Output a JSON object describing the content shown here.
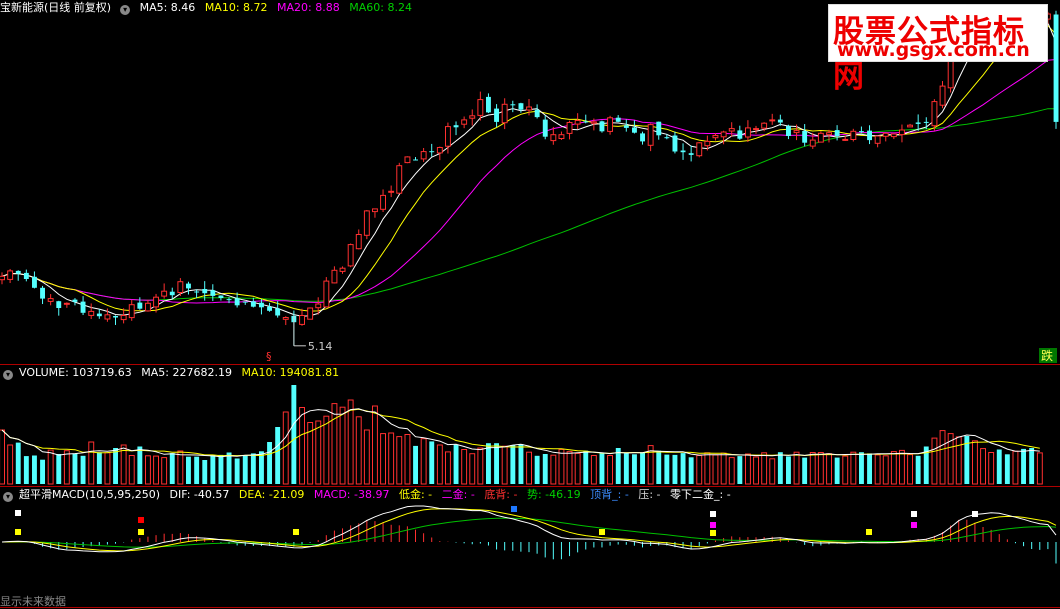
{
  "header_main": {
    "title": "宝新能源(日线 前复权)",
    "ma5": "MA5: 8.46",
    "ma10": "MA10: 8.72",
    "ma20": "MA20: 8.88",
    "ma60": "MA60: 8.24"
  },
  "header_volume": {
    "title": "VOLUME: 103719.63",
    "ma5": "MA5: 227682.19",
    "ma10": "MA10: 194081.81"
  },
  "header_macd": {
    "title": "超平滑MACD(10,5,95,250)",
    "dif": "DIF: -40.57",
    "dea": "DEA: -21.09",
    "macd": "MACD: -38.97",
    "dijin": "低金: -",
    "erjin": "二金: -",
    "dibei": "底背: -",
    "shi": "势: -46.19",
    "dingbei": "顶背_: -",
    "ya": "压: -",
    "lingxia": "零下二金_: -"
  },
  "watermark": {
    "line1": "股票公式指标网",
    "line2": "www.gsgx.com.cn"
  },
  "annotations": {
    "low_price": "5.14",
    "drop": "跌",
    "marker": "§",
    "future": "显示未来数据"
  },
  "colors": {
    "up": "#ff3030",
    "down": "#54ffff",
    "ma5": "#ffffff",
    "ma10": "#ffff00",
    "ma20": "#ff00ff",
    "ma60": "#00c000",
    "volume_ma5": "#ffffff",
    "volume_ma10": "#ffff00"
  },
  "chart_data": {
    "type": "candlestick",
    "ylim": [
      4.9,
      10.0
    ],
    "close": [
      6.17,
      6.25,
      6.21,
      6.13,
      6.0,
      5.84,
      5.84,
      5.7,
      5.77,
      5.79,
      5.63,
      5.65,
      5.58,
      5.6,
      5.56,
      5.59,
      5.75,
      5.69,
      5.77,
      5.86,
      5.95,
      5.89,
      6.09,
      5.99,
      5.94,
      5.92,
      5.88,
      5.85,
      5.82,
      5.74,
      5.79,
      5.72,
      5.71,
      5.66,
      5.59,
      5.56,
      5.49,
      5.59,
      5.7,
      5.76,
      6.1,
      6.26,
      6.29,
      6.64,
      6.79,
      7.14,
      7.17,
      7.37,
      7.43,
      7.81,
      7.94,
      7.9,
      8.02,
      8.01,
      8.08,
      8.39,
      8.38,
      8.49,
      8.55,
      8.79,
      8.6,
      8.46,
      8.72,
      8.71,
      8.64,
      8.68,
      8.53,
      8.24,
      8.27,
      8.27,
      8.45,
      8.48,
      8.46,
      8.46,
      8.32,
      8.52,
      8.46,
      8.37,
      8.3,
      8.17,
      8.42,
      8.26,
      8.23,
      8.02,
      8.01,
      7.97,
      8.15,
      8.17,
      8.26,
      8.31,
      8.36,
      8.21,
      8.37,
      8.36,
      8.44,
      8.49,
      8.45,
      8.25,
      8.33,
      8.15,
      8.19,
      8.29,
      8.3,
      8.25,
      8.2,
      8.32,
      8.32,
      8.19,
      8.25,
      8.29,
      8.28,
      8.34,
      8.41,
      8.43,
      8.46,
      8.76,
      8.99,
      9.51,
      9.79,
      9.67,
      9.73,
      9.77,
      10.0,
      9.9,
      9.82,
      9.9,
      9.9,
      9.83,
      9.95,
      10.06,
      8.46
    ],
    "volume": [
      180000,
      130000,
      138000,
      93000,
      95000,
      81000,
      113000,
      100000,
      111000,
      102000,
      94000,
      140000,
      106000,
      104000,
      120000,
      130000,
      95000,
      125000,
      94000,
      93000,
      88000,
      103000,
      110000,
      91000,
      91000,
      80000,
      96000,
      97000,
      105000,
      85000,
      95000,
      102000,
      109000,
      140000,
      190000,
      240000,
      330000,
      255000,
      205000,
      210000,
      226000,
      268000,
      256000,
      280000,
      224000,
      180000,
      260000,
      168000,
      170000,
      158000,
      165000,
      127000,
      151000,
      142000,
      130000,
      107000,
      131000,
      115000,
      101000,
      120000,
      136000,
      136000,
      126000,
      130000,
      133000,
      106000,
      94000,
      100000,
      96000,
      115000,
      108000,
      102000,
      111000,
      95000,
      104000,
      95000,
      120000,
      102000,
      99000,
      105000,
      128000,
      111000,
      98000,
      97000,
      103000,
      89000,
      95000,
      104000,
      97000,
      103000,
      88000,
      93000,
      100000,
      90000,
      104000,
      84000,
      106000,
      92000,
      106000,
      88000,
      105000,
      105000,
      101000,
      88000,
      93000,
      106000,
      106000,
      102000,
      97000,
      94000,
      108000,
      112000,
      98000,
      94000,
      125000,
      153000,
      178000,
      168000,
      157000,
      160000,
      144000,
      118000,
      105000,
      115000,
      99000,
      109000,
      117000,
      120000,
      103719
    ]
  }
}
